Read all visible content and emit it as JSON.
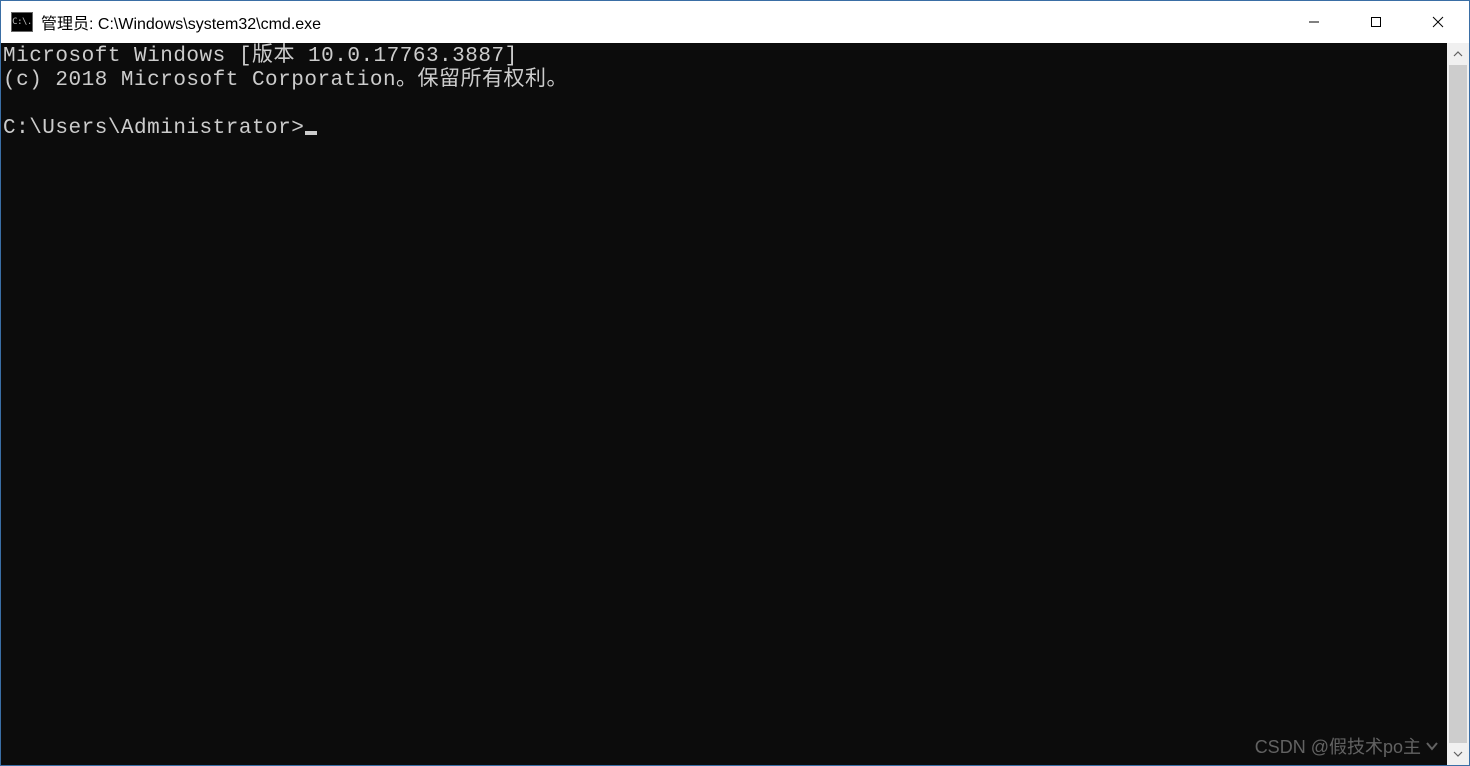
{
  "titlebar": {
    "icon_caption": "C:\\.",
    "title": "管理员: C:\\Windows\\system32\\cmd.exe"
  },
  "terminal": {
    "line1": "Microsoft Windows [版本 10.0.17763.3887]",
    "line2": "(c) 2018 Microsoft Corporation。保留所有权利。",
    "blank": "",
    "prompt": "C:\\Users\\Administrator>"
  },
  "watermark": {
    "text": "CSDN @假技术po主"
  }
}
